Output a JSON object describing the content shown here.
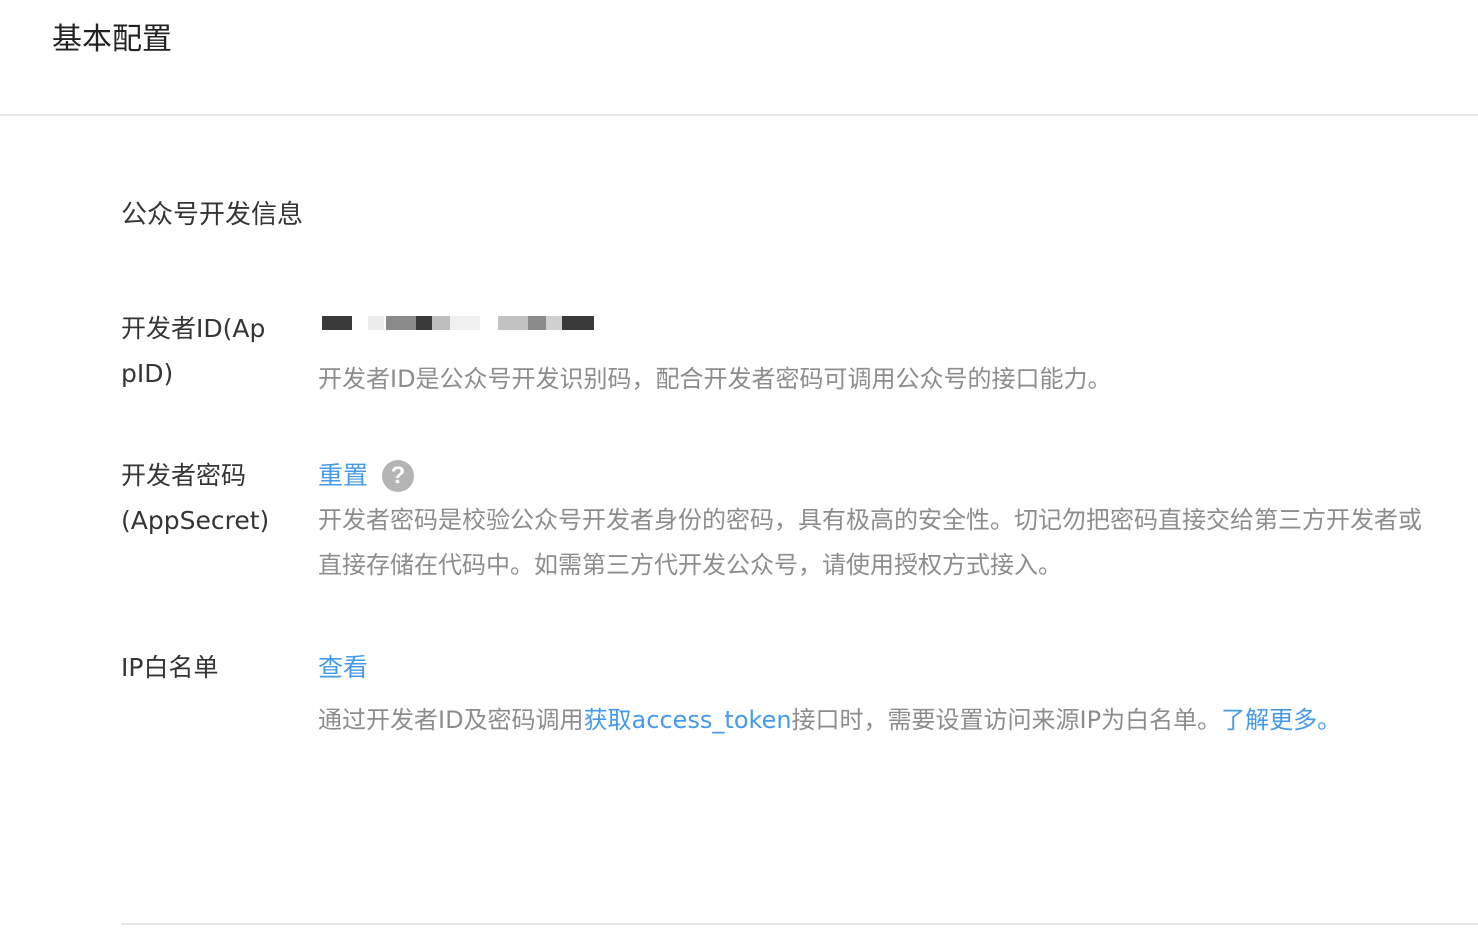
{
  "header": {
    "title": "基本配置"
  },
  "section": {
    "title": "公众号开发信息"
  },
  "fields": {
    "appid": {
      "label": "开发者ID(AppID)",
      "desc": "开发者ID是公众号开发识别码，配合开发者密码可调用公众号的接口能力。"
    },
    "appsecret": {
      "label": "开发者密码(AppSecret)",
      "action": "重置",
      "help_icon": "?",
      "desc": "开发者密码是校验公众号开发者身份的密码，具有极高的安全性。切记勿把密码直接交给第三方开发者或直接存储在代码中。如需第三方代开发公众号，请使用授权方式接入。"
    },
    "ip_whitelist": {
      "label": "IP白名单",
      "action": "查看",
      "desc_before": "通过开发者ID及密码调用",
      "desc_link": "获取access_token",
      "desc_middle": "接口时，需要设置访问来源IP为白名单。",
      "desc_more": "了解更多。"
    }
  },
  "colors": {
    "link": "#459ae9",
    "desc_text": "#8d8d8d",
    "label_text": "#353535",
    "divider": "#e7e7eb",
    "help_icon_bg": "#b4b4b4"
  }
}
